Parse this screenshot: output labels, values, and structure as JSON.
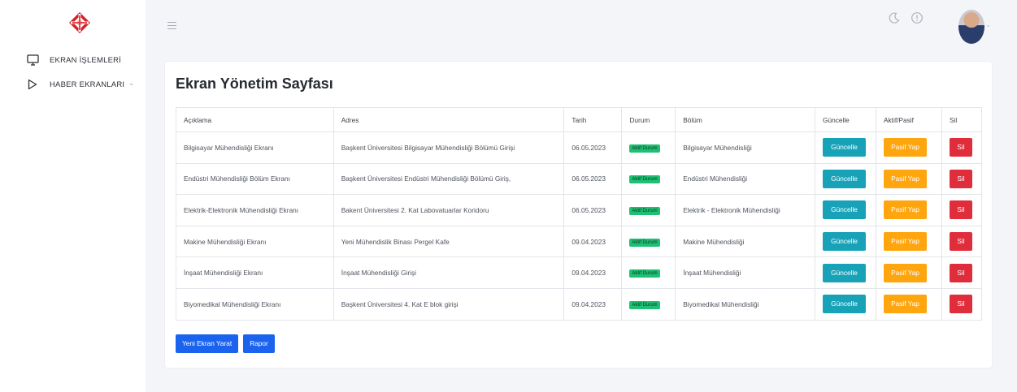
{
  "sidebar": {
    "items": [
      {
        "label": "EKRAN İŞLEMLERİ",
        "icon": "monitor-icon"
      },
      {
        "label": "HABER EKRANLARI",
        "icon": "play-icon"
      }
    ]
  },
  "header": {
    "icons": [
      "menu-icon",
      "moon-icon",
      "alert-icon",
      "avatar"
    ]
  },
  "main": {
    "title": "Ekran Yönetim Sayfası",
    "columns": [
      "Açıklama",
      "Adres",
      "Tarih",
      "Durum",
      "Bölüm",
      "Güncelle",
      "Aktif/Pasif",
      "Sil"
    ],
    "rows": [
      {
        "aciklama": "Bilgisayar Mühendisliği Ekranı",
        "adres": "Başkent Üniversitesi Bilgisayar Mühendisliği Bölümü Girişi",
        "tarih": "06.05.2023",
        "durum": "Aktif Durum",
        "bolum": "Bilgisayar Mühendisliği"
      },
      {
        "aciklama": "Endüstri Mühendisliği Bölüm Ekranı",
        "adres": "Başkent Üniversitesi Endüstri Mühendisliği Bölümü Giriş,",
        "tarih": "06.05.2023",
        "durum": "Aktif Durum",
        "bolum": "Endüstri Mühendisliği"
      },
      {
        "aciklama": "Elektrik-Elektronik Mühendisliği Ekranı",
        "adres": "Bakent Üniversitesi 2. Kat Labovatuarlar Koridoru",
        "tarih": "06.05.2023",
        "durum": "Aktif Durum",
        "bolum": "Elektrik - Elektronik Mühendisliği"
      },
      {
        "aciklama": "Makine Mühendisliği Ekranı",
        "adres": "Yeni Mühendislik Binası Pergel Kafe",
        "tarih": "09.04.2023",
        "durum": "Aktif Durum",
        "bolum": "Makine Mühendisliği"
      },
      {
        "aciklama": "İnşaat Mühendisliği Ekranı",
        "adres": "İnşaat Mühendisliği Girişi",
        "tarih": "09.04.2023",
        "durum": "Aktif Durum",
        "bolum": "İnşaat Mühendisliği"
      },
      {
        "aciklama": "Biyomedikal Mühendisliği Ekranı",
        "adres": "Başkent Üniversitesi 4. Kat E blok girişi",
        "tarih": "09.04.2023",
        "durum": "Aktif Durum",
        "bolum": "Biyomedikal Mühendisliği"
      }
    ],
    "row_actions": {
      "update": "Güncelle",
      "toggle": "Pasif Yap",
      "delete": "Sil"
    },
    "footer": {
      "create": "Yeni Ekran Yarat",
      "report": "Rapor"
    }
  },
  "colors": {
    "info": "#17a2b8",
    "warning": "#ffa50e",
    "danger": "#e02d3c",
    "primary": "#1b63ef",
    "success": "#1fbf74"
  }
}
